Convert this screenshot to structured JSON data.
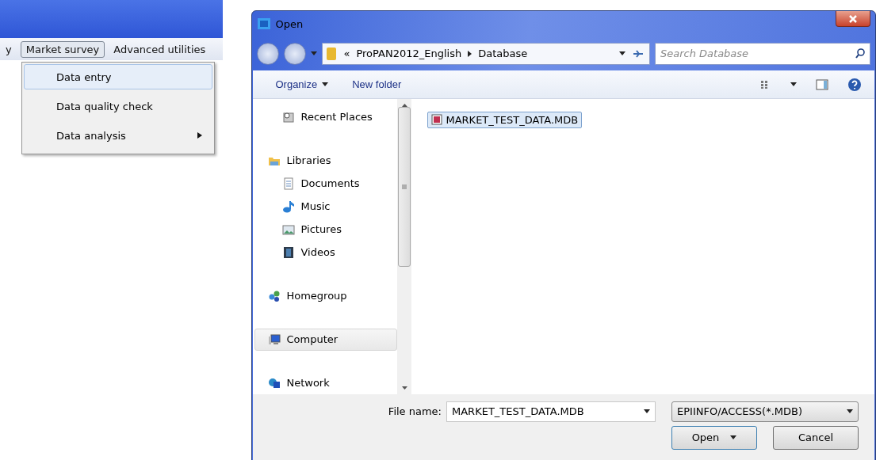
{
  "app": {
    "menu": [
      {
        "label": "y",
        "selected": false
      },
      {
        "label": "Market survey",
        "selected": true
      },
      {
        "label": "Advanced utilities",
        "selected": false
      }
    ],
    "dropdown": [
      {
        "label": "Data entry",
        "selected": true,
        "submenu": false
      },
      {
        "label": "Data quality check",
        "selected": false,
        "submenu": false
      },
      {
        "label": "Data analysis",
        "selected": false,
        "submenu": true
      }
    ]
  },
  "dialog": {
    "title": "Open",
    "breadcrumb": [
      "«",
      "ProPAN2012_English",
      "Database"
    ],
    "search": {
      "placeholder": "Search Database"
    },
    "toolbar": [
      "Organize",
      "New folder"
    ],
    "nav": [
      {
        "label": "Recent Places",
        "kind": "recent",
        "selected": false
      },
      {
        "label": "Libraries",
        "kind": "library",
        "selected": false,
        "children": [
          {
            "label": "Documents",
            "kind": "documents",
            "selected": false
          },
          {
            "label": "Music",
            "kind": "music",
            "selected": false
          },
          {
            "label": "Pictures",
            "kind": "pictures",
            "selected": false
          },
          {
            "label": "Videos",
            "kind": "videos",
            "selected": false
          }
        ]
      },
      {
        "label": "Homegroup",
        "kind": "homegroup",
        "selected": false
      },
      {
        "label": "Computer",
        "kind": "computer",
        "selected": true
      },
      {
        "label": "Network",
        "kind": "network",
        "selected": false
      }
    ],
    "files": [
      {
        "name": "MARKET_TEST_DATA.MDB",
        "selected": true
      }
    ],
    "file_name": {
      "label": "File name:",
      "value": "MARKET_TEST_DATA.MDB"
    },
    "file_type": "EPIINFO/ACCESS(*.MDB)",
    "buttons": [
      "Open",
      "Cancel"
    ]
  }
}
